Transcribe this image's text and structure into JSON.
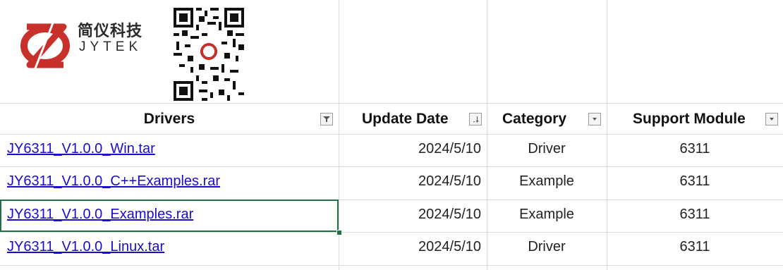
{
  "brand": {
    "name_cn": "简仪科技",
    "name_en": "JYTEK",
    "colors": {
      "logo": "#c8302c",
      "link": "#1a0dcc",
      "selection": "#207245"
    }
  },
  "headers": {
    "drivers": "Drivers",
    "update_date": "Update Date",
    "category": "Category",
    "support_module": "Support Module"
  },
  "rows": [
    {
      "driver": "JY6311_V1.0.0_Win.tar",
      "date": "2024/5/10",
      "category": "Driver",
      "module": "6311"
    },
    {
      "driver": "JY6311_V1.0.0_C++Examples.rar",
      "date": "2024/5/10",
      "category": "Example",
      "module": "6311"
    },
    {
      "driver": "JY6311_V1.0.0_Examples.rar",
      "date": "2024/5/10",
      "category": "Example",
      "module": "6311"
    },
    {
      "driver": "JY6311_V1.0.0_Linux.tar",
      "date": "2024/5/10",
      "category": "Driver",
      "module": "6311"
    }
  ],
  "icons": {
    "drivers_filter": "filter-active-icon",
    "date_filter": "sort-ascending-icon",
    "category_filter": "dropdown-arrow-icon",
    "module_filter": "dropdown-arrow-icon"
  },
  "selected_row": 2
}
